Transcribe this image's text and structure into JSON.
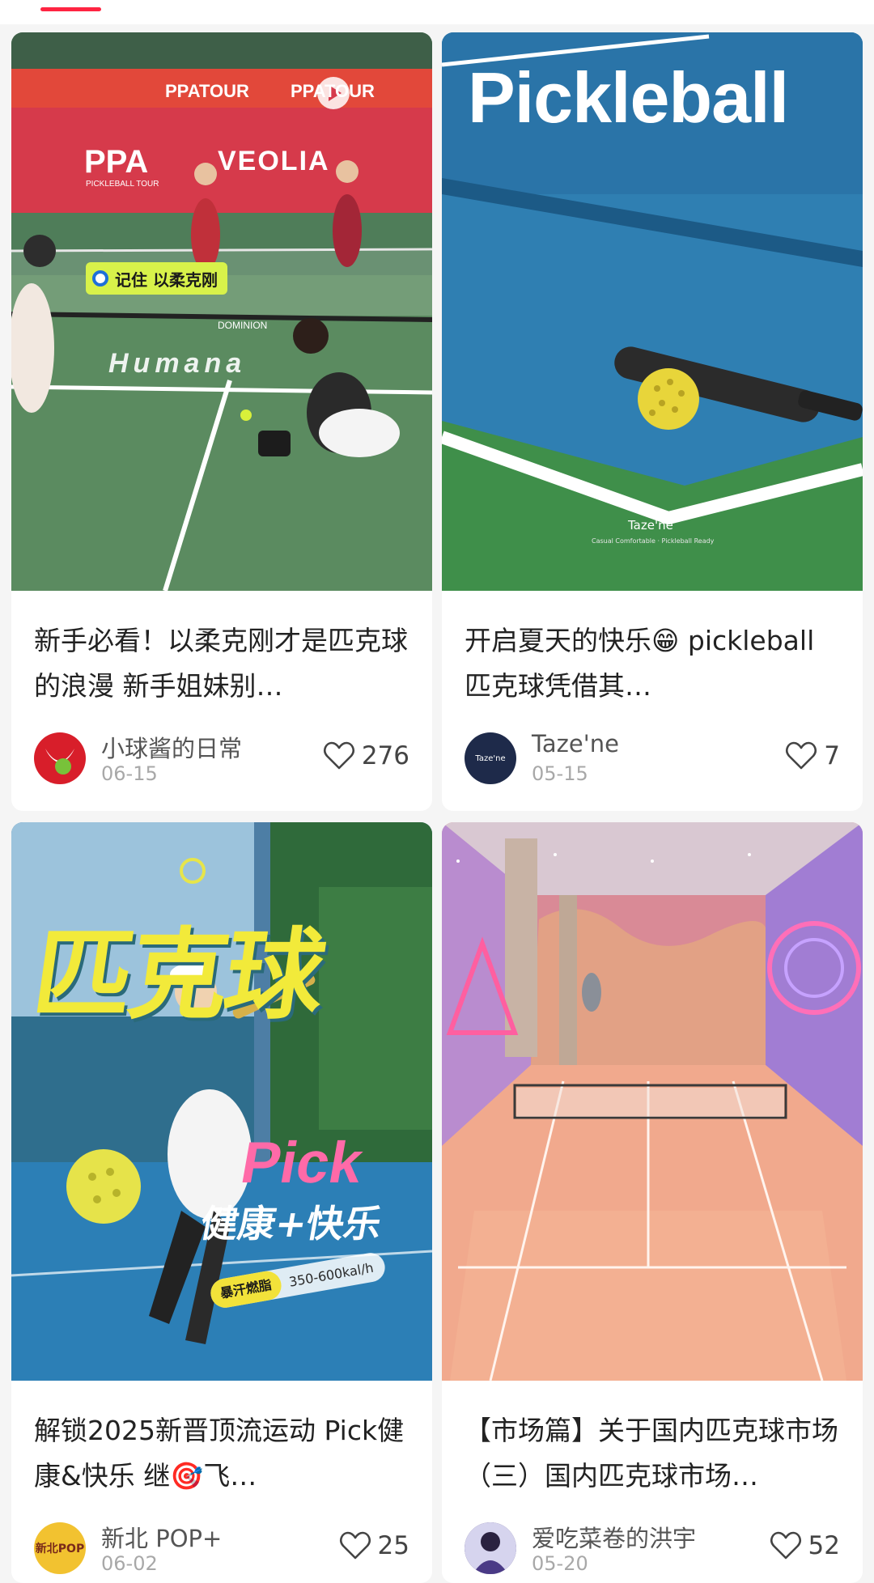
{
  "feed": {
    "cards": [
      {
        "title": "新手必看！以柔克刚才是匹克球的浪漫 新手姐妹别…",
        "author": "小球酱的日常",
        "date": "06-15",
        "likes": "276",
        "image": {
          "overlay_tag": "记住 以柔克刚",
          "banner_text": "PPATOUR",
          "brand_left": "PPA",
          "brand_left_sub": "PICKLEBALL TOUR",
          "brand_right": "VEOLIA",
          "court_text": "Humana",
          "net_text": "DOMINION"
        }
      },
      {
        "title": "开启夏天的快乐😁 pickleball 匹克球凭借其…",
        "author": "Taze'ne",
        "date": "05-15",
        "likes": "7",
        "avatar_text": "Taze'ne",
        "image": {
          "headline": "Pickleball",
          "brand": "Taze'ne",
          "tagline": "Casual Comfortable · Pickleball Ready"
        }
      },
      {
        "title": "解锁2025新晋顶流运动 Pick健康&快乐 继🎯飞…",
        "author": "新北 POP+",
        "date": "06-02",
        "likes": "25",
        "avatar_text": "新北POP",
        "image": {
          "headline": "匹克球",
          "sub_en": "Pick",
          "sub_cn": "健康+快乐",
          "badge": "暴汗燃脂",
          "calories": "350-600kal/h"
        }
      },
      {
        "title": "【市场篇】关于国内匹克球市场（三）国内匹克球市场…",
        "author": "爱吃菜卷的洪宇",
        "date": "05-20",
        "likes": "52"
      }
    ]
  },
  "colors": {
    "accent": "#ff2442",
    "text": "#222222",
    "muted": "#a8a8a8"
  },
  "icons": [
    "heart-outline-icon",
    "play-icon",
    "location-pin-icon"
  ]
}
